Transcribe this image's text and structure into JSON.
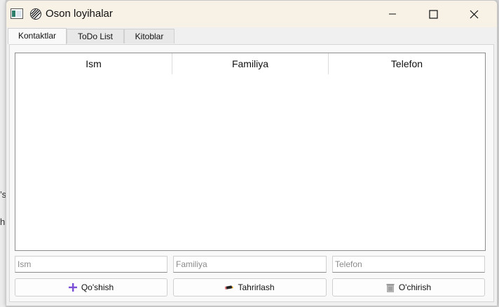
{
  "window": {
    "title": "Oson loyihalar"
  },
  "tabs": [
    {
      "label": "Kontaktlar",
      "active": true
    },
    {
      "label": "ToDo List",
      "active": false
    },
    {
      "label": "Kitoblar",
      "active": false
    }
  ],
  "table": {
    "columns": [
      "Ism",
      "Familiya",
      "Telefon"
    ],
    "rows": []
  },
  "inputs": {
    "first_name": {
      "placeholder": "Ism",
      "value": ""
    },
    "last_name": {
      "placeholder": "Familiya",
      "value": ""
    },
    "phone": {
      "placeholder": "Telefon",
      "value": ""
    }
  },
  "buttons": {
    "add": {
      "label": "Qo'shish",
      "icon": "plus-icon"
    },
    "edit": {
      "label": "Tahrirlash",
      "icon": "pencil-icon"
    },
    "delete": {
      "label": "O'chirish",
      "icon": "trash-icon"
    }
  },
  "background": {
    "left_chars": [
      "’s",
      "h"
    ]
  },
  "colors": {
    "titlebar": "#f7f1e6",
    "accent_plus": "#7a4fd6"
  }
}
